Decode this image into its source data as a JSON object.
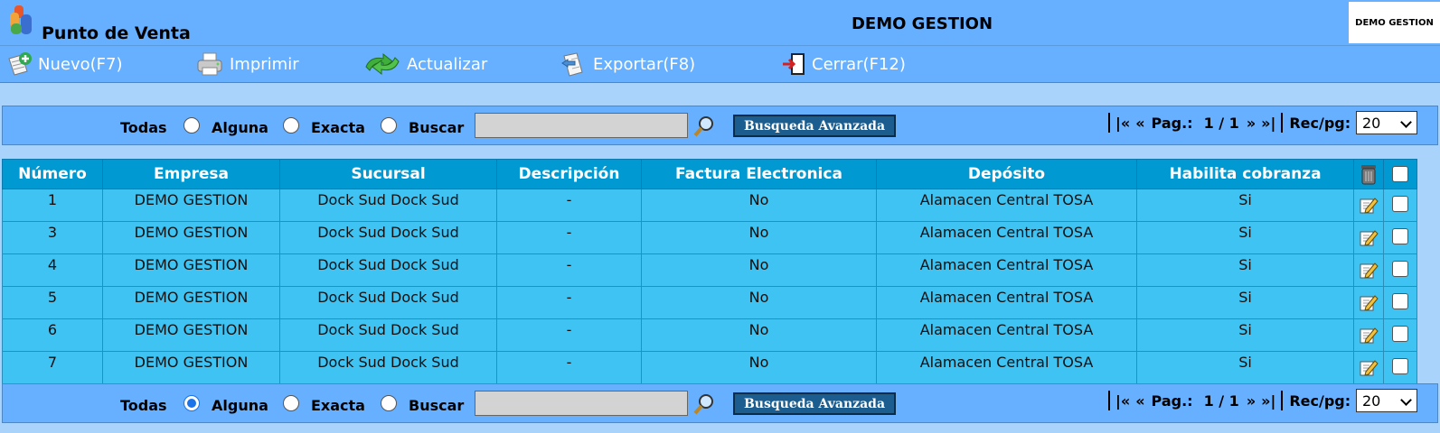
{
  "header": {
    "app_title": "Punto de Venta",
    "company": "DEMO GESTION",
    "logo_text": "DEMO GESTION"
  },
  "toolbar": {
    "nuevo": "Nuevo(F7)",
    "imprimir": "Imprimir",
    "actualizar": "Actualizar",
    "exportar": "Exportar(F8)",
    "cerrar": "Cerrar(F12)"
  },
  "search_top": {
    "todas": "Todas",
    "alguna": "Alguna",
    "exacta": "Exacta",
    "buscar": "Buscar",
    "query": "",
    "advanced": "Busqueda Avanzada",
    "selected": "none",
    "pager_first": "|«",
    "pager_prev": "«",
    "pager_label": "Pag.:",
    "pager_value": "1 / 1",
    "pager_next": "»",
    "pager_last": "»|",
    "rec_label": "Rec/pg:",
    "rec_value": "20"
  },
  "search_bottom": {
    "todas": "Todas",
    "alguna": "Alguna",
    "exacta": "Exacta",
    "buscar": "Buscar",
    "query": "",
    "advanced": "Busqueda Avanzada",
    "selected": "todas",
    "pager_first": "|«",
    "pager_prev": "«",
    "pager_label": "Pag.:",
    "pager_value": "1 / 1",
    "pager_next": "»",
    "pager_last": "»|",
    "rec_label": "Rec/pg:",
    "rec_value": "20"
  },
  "table": {
    "headers": [
      "Número",
      "Empresa",
      "Sucursal",
      "Descripción",
      "Factura Electronica",
      "Depósito",
      "Habilita cobranza"
    ],
    "rows": [
      [
        "1",
        "DEMO GESTION",
        "Dock Sud Dock Sud",
        "-",
        "No",
        "Alamacen Central TOSA",
        "Si"
      ],
      [
        "3",
        "DEMO GESTION",
        "Dock Sud Dock Sud",
        "-",
        "No",
        "Alamacen Central TOSA",
        "Si"
      ],
      [
        "4",
        "DEMO GESTION",
        "Dock Sud Dock Sud",
        "-",
        "No",
        "Alamacen Central TOSA",
        "Si"
      ],
      [
        "5",
        "DEMO GESTION",
        "Dock Sud Dock Sud",
        "-",
        "No",
        "Alamacen Central TOSA",
        "Si"
      ],
      [
        "6",
        "DEMO GESTION",
        "Dock Sud Dock Sud",
        "-",
        "No",
        "Alamacen Central TOSA",
        "Si"
      ],
      [
        "7",
        "DEMO GESTION",
        "Dock Sud Dock Sud",
        "-",
        "No",
        "Alamacen Central TOSA",
        "Si"
      ]
    ]
  },
  "colors": {
    "bar": "#67b0ff",
    "page_bg": "#a9d3fb",
    "header_cell": "#0199d2",
    "row_cell": "#3ec3f3",
    "advanced_btn": "#1c5d8f"
  },
  "icons": {
    "nuevo": "new-document-icon",
    "imprimir": "printer-icon",
    "actualizar": "refresh-arrows-icon",
    "exportar": "export-icon",
    "cerrar": "exit-door-icon",
    "search": "magnifier-icon",
    "delete": "trash-can-icon",
    "edit": "edit-pencil-icon"
  }
}
